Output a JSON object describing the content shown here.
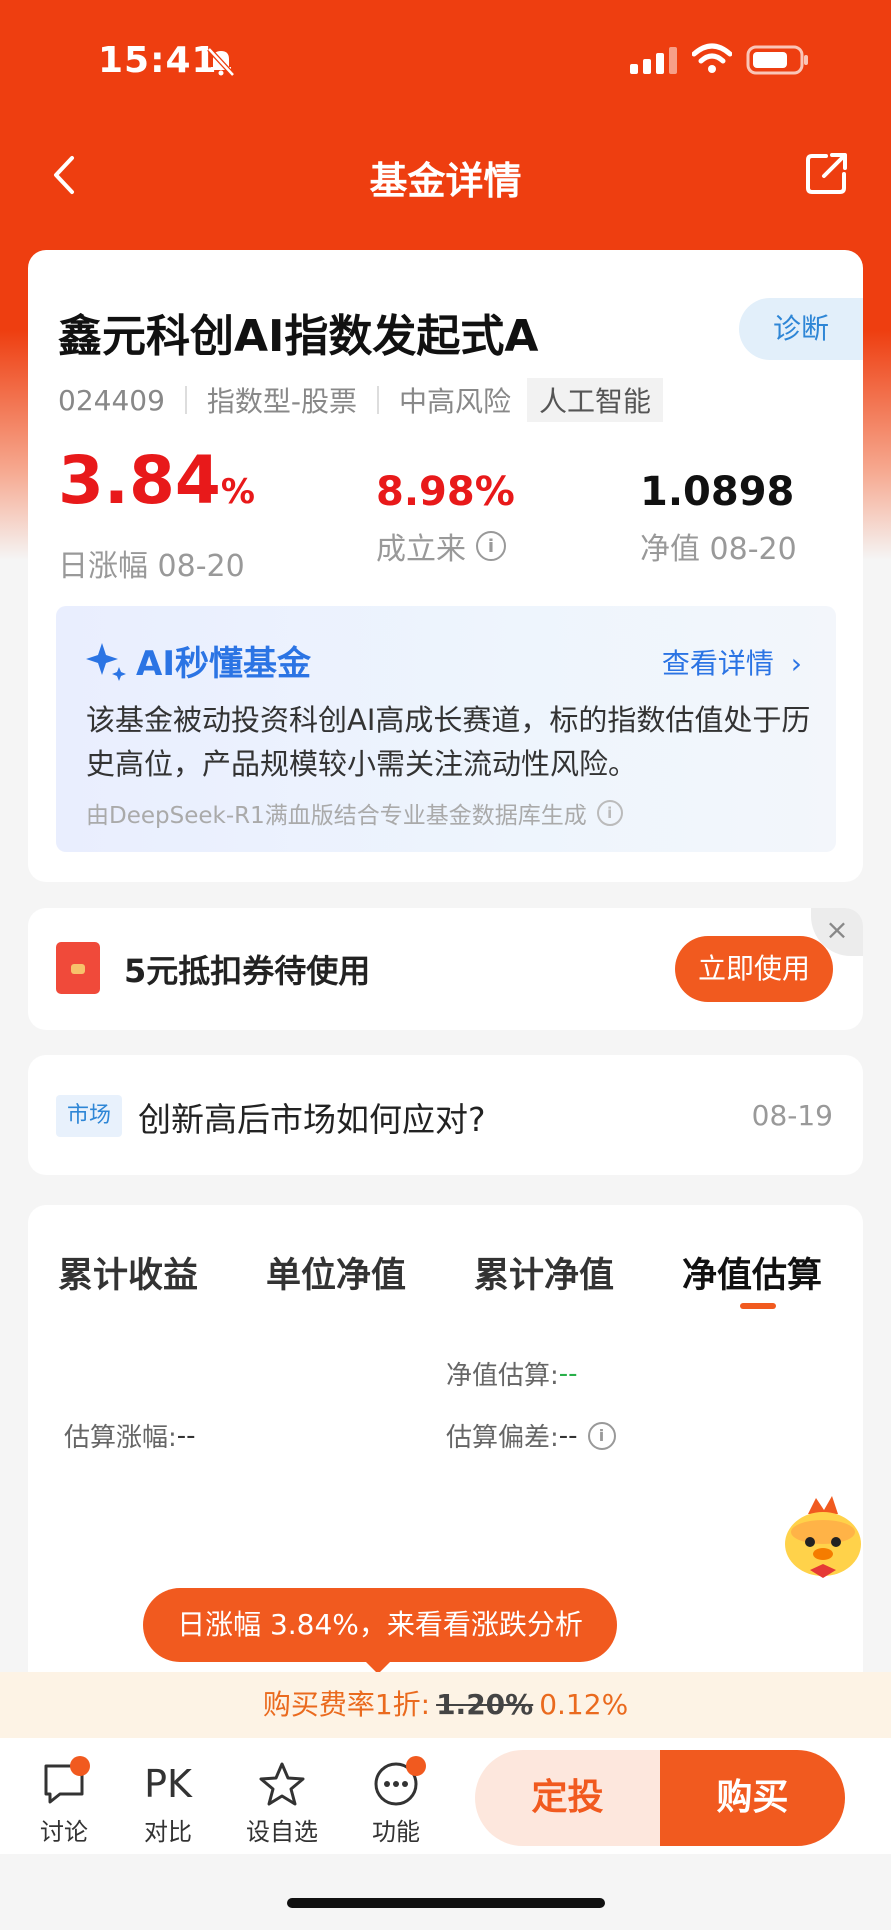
{
  "status_bar": {
    "time": "15:41"
  },
  "nav": {
    "title": "基金详情"
  },
  "fund": {
    "name": "鑫元科创AI指数发起式A",
    "diagnose_label": "诊断",
    "code": "024409",
    "type": "指数型-股票",
    "risk": "中高风险",
    "theme_tag": "人工智能",
    "daily_change_value": "3.84",
    "daily_change_unit": "%",
    "daily_change_label": "日涨幅 08-20",
    "since_inception_value": "8.98%",
    "since_inception_label": "成立来",
    "nav_value": "1.0898",
    "nav_label": "净值 08-20",
    "accent_color": "#e8191a"
  },
  "ai_summary": {
    "title": "AI秒懂基金",
    "more": "查看详情",
    "text": "该基金被动投资科创AI高成长赛道，标的指数估值处于历史高位，产品规模较小需关注流动性风险。",
    "footer": "由DeepSeek-R1满血版结合专业基金数据库生成"
  },
  "coupon": {
    "text": "5元抵扣券待使用",
    "button": "立即使用"
  },
  "news": {
    "tag": "市场",
    "title": "创新高后市场如何应对?",
    "date": "08-19"
  },
  "chart_tabs": {
    "tabs": [
      "累计收益",
      "单位净值",
      "累计净值",
      "净值估算"
    ],
    "active_index": 3
  },
  "estimate": {
    "nav_est_label": "净值估算:",
    "nav_est_value": "--",
    "change_est_label": "估算涨幅:",
    "change_est_value": "--",
    "deviation_label": "估算偏差:",
    "deviation_value": "--"
  },
  "bubble": {
    "text": "日涨幅 3.84%，来看看涨跌分析"
  },
  "fee": {
    "label": "购买费率1折:",
    "original": "1.20%",
    "discounted": "0.12%"
  },
  "bottom_bar": {
    "items": [
      {
        "label": "讨论",
        "icon": "chat-icon"
      },
      {
        "label": "对比",
        "icon": "pk-icon",
        "glyph": "PK"
      },
      {
        "label": "设自选",
        "icon": "star-icon"
      },
      {
        "label": "功能",
        "icon": "more-icon"
      }
    ],
    "fixed_invest": "定投",
    "buy": "购买"
  },
  "colors": {
    "brand": "#ee3e10",
    "accent": "#f15a1f",
    "ai_blue": "#2b74e4"
  }
}
